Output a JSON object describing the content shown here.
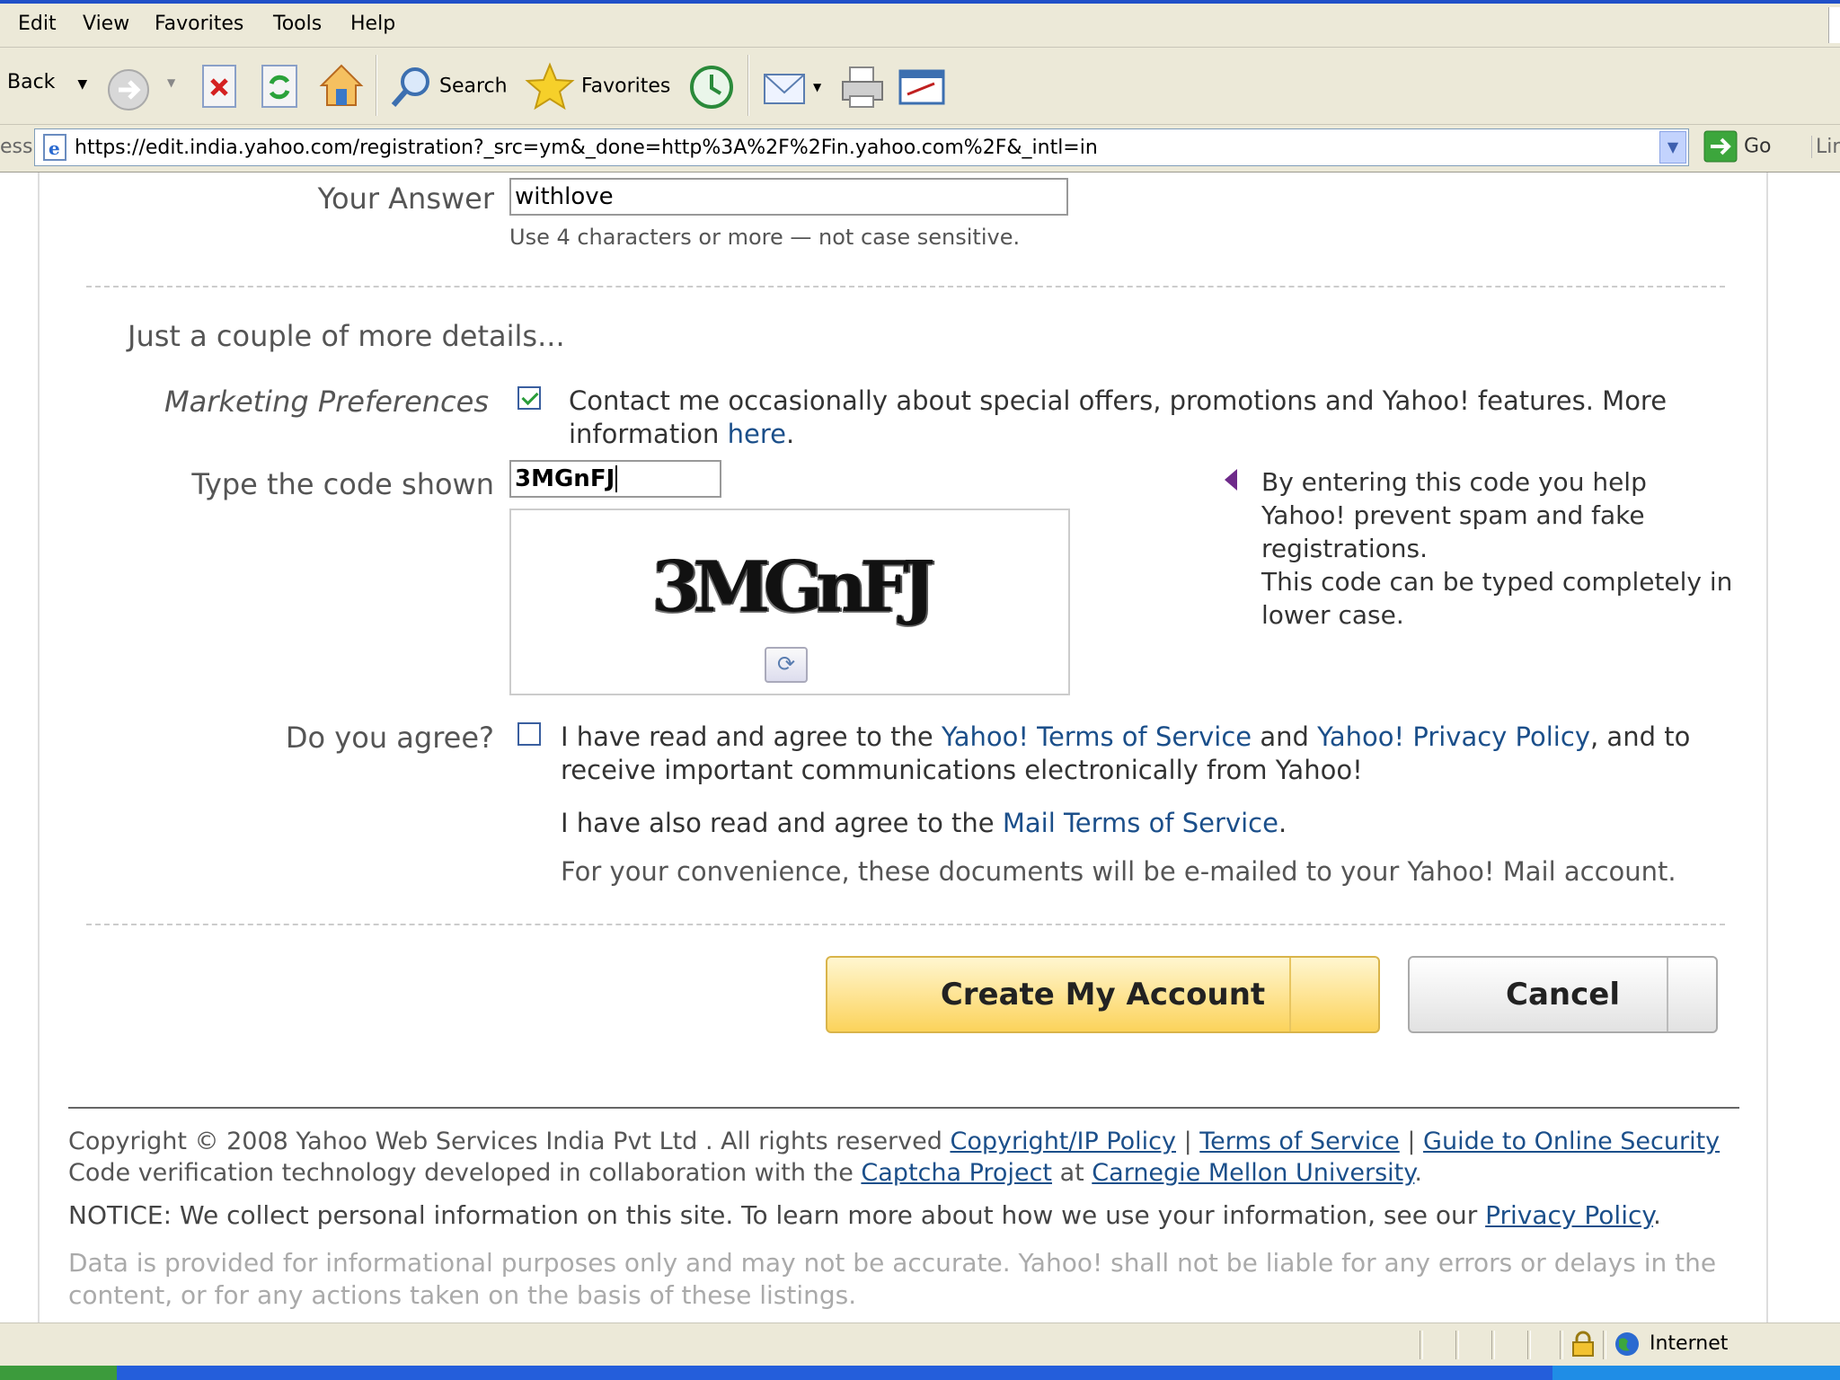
{
  "menu": [
    "Edit",
    "View",
    "Favorites",
    "Tools",
    "Help"
  ],
  "toolbar": {
    "back": "Back",
    "search": "Search",
    "favorites": "Favorites"
  },
  "address": {
    "label": "ess",
    "url": "https://edit.india.yahoo.com/registration?_src=ym&_done=http%3A%2F%2Fin.yahoo.com%2F&_intl=in",
    "go": "Go",
    "links": "Lin"
  },
  "form": {
    "answer_label": "Your Answer",
    "answer_value": "withlove",
    "answer_hint": "Use 4 characters or more — not case sensitive.",
    "section_title": "Just a couple of more details...",
    "marketing_label": "Marketing Preferences",
    "marketing_checked": true,
    "marketing_text": "Contact me occasionally about special offers, promotions and Yahoo! features. More",
    "marketing_text2": "information ",
    "marketing_link": "here",
    "marketing_end": ".",
    "code_label": "Type the code shown",
    "code_value": "3MGnFJ",
    "captcha_text": "3MGnFJ",
    "tip_line1": "By entering this code you help",
    "tip_line2": "Yahoo! prevent spam and fake",
    "tip_line3": "registrations.",
    "tip_line4": "This code can be typed completely in",
    "tip_line5": "lower case.",
    "agree_label": "Do you agree?",
    "agree_checked": false,
    "agree_t1": "I have read and agree to the ",
    "agree_l1": "Yahoo! Terms of Service",
    "agree_t2": " and ",
    "agree_l2": "Yahoo! Privacy Policy",
    "agree_t3": ", and to",
    "agree_t4": "receive important communications electronically from Yahoo!",
    "mail_t1": "I have also read and agree to the ",
    "mail_l1": "Mail Terms of Service",
    "mail_t2": ".",
    "convenience": "For your convenience, these documents will be e-mailed to your Yahoo! Mail account."
  },
  "buttons": {
    "create": "Create My Account",
    "cancel": "Cancel"
  },
  "footer": {
    "copyright": "Copyright © 2008 Yahoo Web Services India Pvt Ltd . All rights reserved ",
    "copyright_link": "Copyright/IP Policy",
    "sep1": " | ",
    "tos_link": "Terms of Service",
    "sep2": " | ",
    "security_link": "Guide to Online Security",
    "code_t1": "Code verification technology developed in collaboration with the ",
    "captcha_link": "Captcha Project",
    "code_t2": " at ",
    "cmu_link": "Carnegie Mellon University",
    "code_t3": ".",
    "notice_t1": "NOTICE: We collect personal information on this site. To learn more about how we use your information, see our ",
    "privacy_link": "Privacy Policy",
    "notice_t2": ".",
    "disclaimer": "Data is provided for informational purposes only and may not be accurate. Yahoo! shall not be liable for any errors or delays in the content, or for any actions taken on the basis of these listings."
  },
  "status": {
    "zone": "Internet"
  },
  "colors": {
    "link": "#1b4f8a",
    "create_button": "#fcd35b",
    "titlebar": "#2050c8"
  }
}
